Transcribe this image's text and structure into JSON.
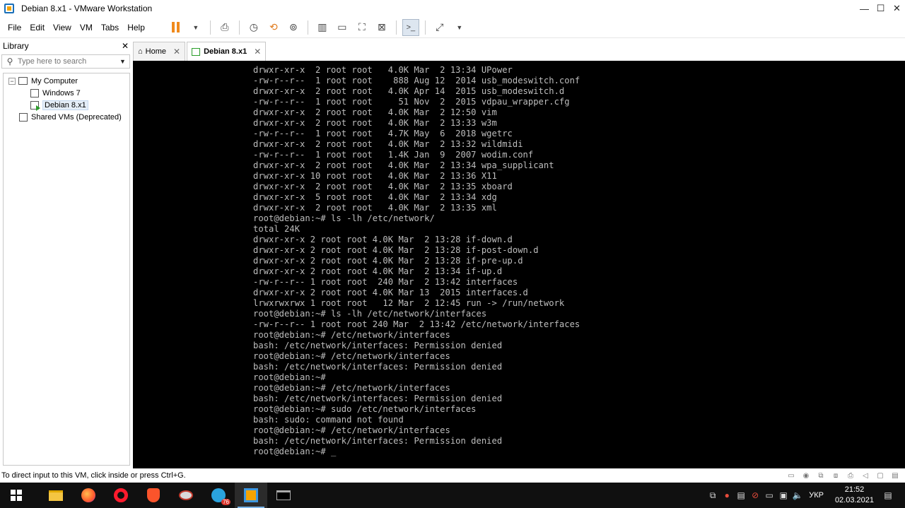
{
  "window": {
    "title": "Debian 8.x1 - VMware Workstation",
    "minimize": "—",
    "maximize": "☐",
    "close": "✕"
  },
  "menu": [
    "File",
    "Edit",
    "View",
    "VM",
    "Tabs",
    "Help"
  ],
  "library": {
    "title": "Library",
    "close": "✕",
    "search_placeholder": "Type here to search",
    "tree": {
      "my_computer": "My Computer",
      "windows7": "Windows 7",
      "debian": "Debian 8.x1",
      "shared": "Shared VMs (Deprecated)"
    }
  },
  "tabs": {
    "home": "Home",
    "debian": "Debian 8.x1",
    "close": "✕"
  },
  "terminal": [
    "drwxr-xr-x  2 root root   4.0K Mar  2 13:34 UPower",
    "-rw-r--r--  1 root root    888 Aug 12  2014 usb_modeswitch.conf",
    "drwxr-xr-x  2 root root   4.0K Apr 14  2015 usb_modeswitch.d",
    "-rw-r--r--  1 root root     51 Nov  2  2015 vdpau_wrapper.cfg",
    "drwxr-xr-x  2 root root   4.0K Mar  2 12:50 vim",
    "drwxr-xr-x  2 root root   4.0K Mar  2 13:33 w3m",
    "-rw-r--r--  1 root root   4.7K May  6  2018 wgetrc",
    "drwxr-xr-x  2 root root   4.0K Mar  2 13:32 wildmidi",
    "-rw-r--r--  1 root root   1.4K Jan  9  2007 wodim.conf",
    "drwxr-xr-x  2 root root   4.0K Mar  2 13:34 wpa_supplicant",
    "drwxr-xr-x 10 root root   4.0K Mar  2 13:36 X11",
    "drwxr-xr-x  2 root root   4.0K Mar  2 13:35 xboard",
    "drwxr-xr-x  5 root root   4.0K Mar  2 13:34 xdg",
    "drwxr-xr-x  2 root root   4.0K Mar  2 13:35 xml",
    "root@debian:~# ls -lh /etc/network/",
    "total 24K",
    "drwxr-xr-x 2 root root 4.0K Mar  2 13:28 if-down.d",
    "drwxr-xr-x 2 root root 4.0K Mar  2 13:28 if-post-down.d",
    "drwxr-xr-x 2 root root 4.0K Mar  2 13:28 if-pre-up.d",
    "drwxr-xr-x 2 root root 4.0K Mar  2 13:34 if-up.d",
    "-rw-r--r-- 1 root root  240 Mar  2 13:42 interfaces",
    "drwxr-xr-x 2 root root 4.0K Mar 13  2015 interfaces.d",
    "lrwxrwxrwx 1 root root   12 Mar  2 12:45 run -> /run/network",
    "root@debian:~# ls -lh /etc/network/interfaces",
    "-rw-r--r-- 1 root root 240 Mar  2 13:42 /etc/network/interfaces",
    "root@debian:~# /etc/network/interfaces",
    "bash: /etc/network/interfaces: Permission denied",
    "root@debian:~# /etc/network/interfaces",
    "bash: /etc/network/interfaces: Permission denied",
    "root@debian:~#",
    "root@debian:~# /etc/network/interfaces",
    "bash: /etc/network/interfaces: Permission denied",
    "root@debian:~# sudo /etc/network/interfaces",
    "bash: sudo: command not found",
    "root@debian:~# /etc/network/interfaces",
    "bash: /etc/network/interfaces: Permission denied",
    "root@debian:~# _"
  ],
  "status": {
    "message": "To direct input to this VM, click inside or press Ctrl+G."
  },
  "taskbar": {
    "lang": "УКР",
    "time": "21:52",
    "date": "02.03.2021",
    "telegram_badge": "76"
  },
  "colors": {
    "accent": "#1a6fb8",
    "pause": "#f08a1c",
    "terminal_bg": "#000000",
    "terminal_fg": "#bdbdbd"
  }
}
